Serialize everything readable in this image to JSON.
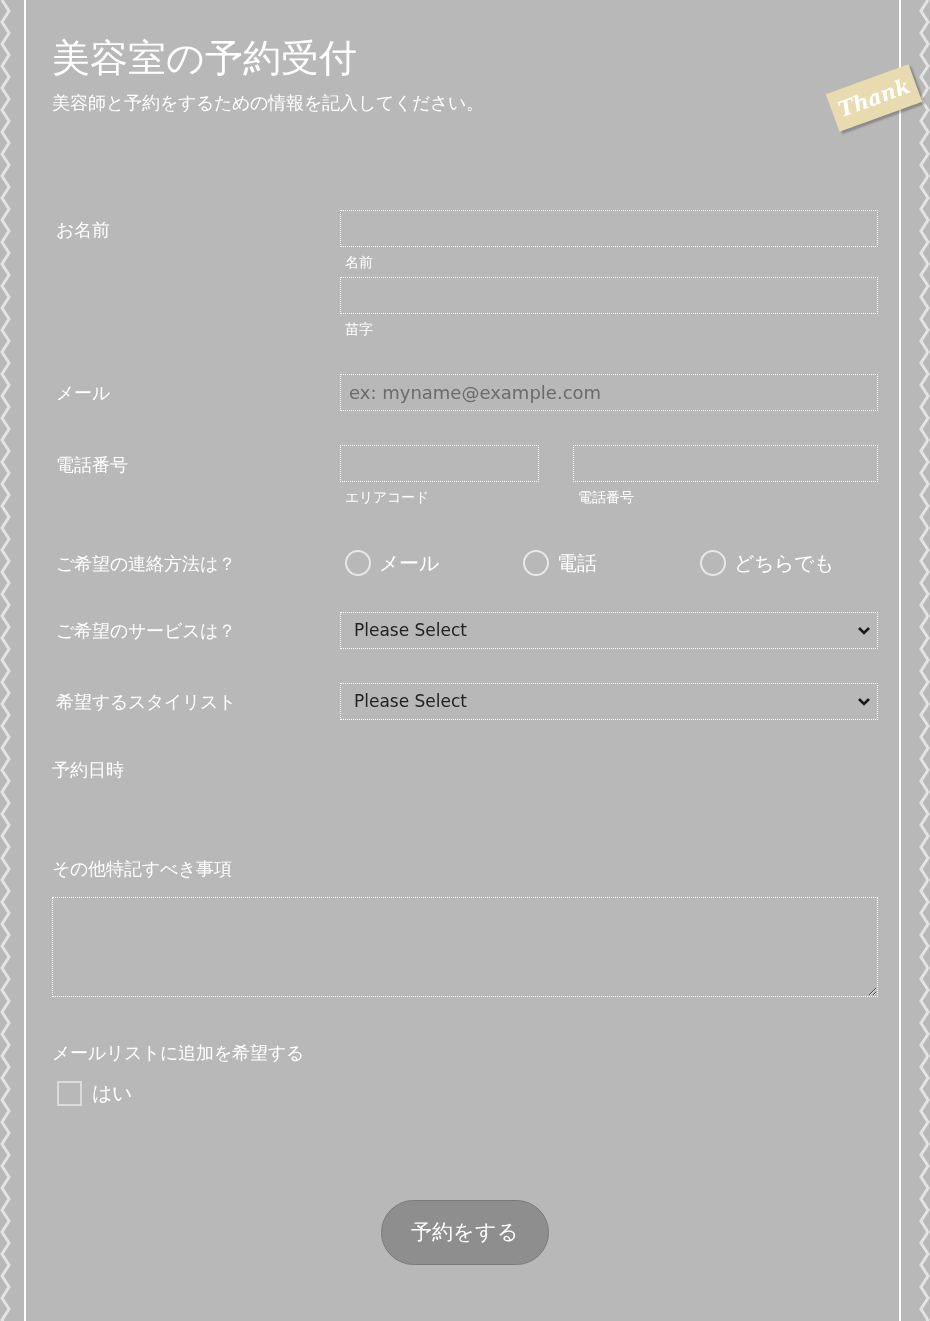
{
  "title": "美容室の予約受付",
  "subtitle": "美容師と予約をするための情報を記入してください。",
  "ribbon": "Thank",
  "fields": [
    {
      "kind": "name",
      "label": "お名前",
      "inputs": [
        {
          "sublabel": "名前"
        },
        {
          "sublabel": "苗字"
        }
      ]
    },
    {
      "kind": "email",
      "label": "メール",
      "placeholder": "ex: myname@example.com"
    },
    {
      "kind": "phone",
      "label": "電話番号",
      "inputs": [
        {
          "sublabel": "エリアコード"
        },
        {
          "sublabel": "電話番号"
        }
      ]
    },
    {
      "kind": "radio",
      "label": "ご希望の連絡方法は？",
      "options": [
        {
          "label": "メール",
          "selected": false
        },
        {
          "label": "電話",
          "selected": false
        },
        {
          "label": "どちらでも",
          "selected": false
        }
      ]
    },
    {
      "kind": "select",
      "label": "ご希望のサービスは？",
      "value": "Please Select"
    },
    {
      "kind": "select",
      "label": "希望するスタイリスト",
      "value": "Please Select"
    },
    {
      "kind": "heading",
      "label": "予約日時"
    },
    {
      "kind": "textarea",
      "label": "その他特記すべき事項"
    },
    {
      "kind": "checkbox",
      "label": "メールリストに追加を希望する",
      "option": "はい",
      "checked": false
    }
  ],
  "submit": "予約をする"
}
